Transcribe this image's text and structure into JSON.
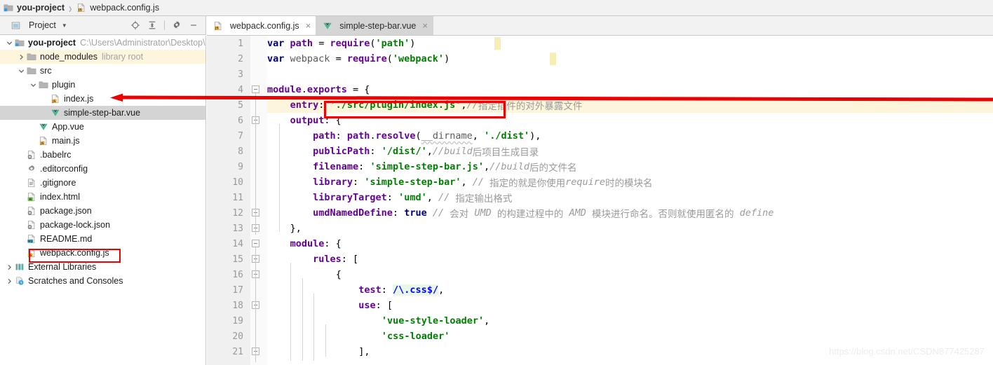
{
  "breadcrumb": {
    "project": "you-project",
    "separator": "›",
    "file": "webpack.config.js",
    "project_icon": "module-folder-icon",
    "file_icon": "js-file-icon"
  },
  "project_panel": {
    "title": "Project",
    "caret": "▼",
    "tools": [
      {
        "name": "locate-icon",
        "title": "Select Opened File"
      },
      {
        "name": "collapse-all-icon",
        "title": "Collapse All"
      },
      {
        "name": "gear-icon",
        "title": "Settings"
      },
      {
        "name": "minimize-icon",
        "title": "Hide"
      }
    ]
  },
  "tabs": [
    {
      "label": "webpack.config.js",
      "icon": "js-file-icon",
      "active": true,
      "close": "×"
    },
    {
      "label": "simple-step-bar.vue",
      "icon": "vue-file-icon",
      "active": false,
      "close": "×"
    }
  ],
  "tree": [
    {
      "depth": 0,
      "arrow": "expanded",
      "icon": "module-folder-icon",
      "name": "you-project",
      "bold": true,
      "note": "C:\\Users\\Administrator\\Desktop\\t",
      "state": "normal"
    },
    {
      "depth": 1,
      "arrow": "collapsed",
      "icon": "folder-icon",
      "name": "node_modules",
      "bold": false,
      "note": "library root",
      "state": "hl"
    },
    {
      "depth": 1,
      "arrow": "expanded",
      "icon": "folder-icon",
      "name": "src",
      "bold": false,
      "note": "",
      "state": "normal"
    },
    {
      "depth": 2,
      "arrow": "expanded",
      "icon": "folder-icon",
      "name": "plugin",
      "bold": false,
      "note": "",
      "state": "normal"
    },
    {
      "depth": 3,
      "arrow": "none",
      "icon": "js-file-icon",
      "name": "index.js",
      "bold": false,
      "note": "",
      "state": "normal"
    },
    {
      "depth": 3,
      "arrow": "none",
      "icon": "vue-file-icon",
      "name": "simple-step-bar.vue",
      "bold": false,
      "note": "",
      "state": "selected"
    },
    {
      "depth": 2,
      "arrow": "none",
      "icon": "vue-file-icon",
      "name": "App.vue",
      "bold": false,
      "note": "",
      "state": "normal"
    },
    {
      "depth": 2,
      "arrow": "none",
      "icon": "js-file-icon",
      "name": "main.js",
      "bold": false,
      "note": "",
      "state": "normal"
    },
    {
      "depth": 1,
      "arrow": "none",
      "icon": "json-file-icon",
      "name": ".babelrc",
      "bold": false,
      "note": "",
      "state": "normal"
    },
    {
      "depth": 1,
      "arrow": "none",
      "icon": "gear-file-icon",
      "name": ".editorconfig",
      "bold": false,
      "note": "",
      "state": "normal"
    },
    {
      "depth": 1,
      "arrow": "none",
      "icon": "text-file-icon",
      "name": ".gitignore",
      "bold": false,
      "note": "",
      "state": "normal"
    },
    {
      "depth": 1,
      "arrow": "none",
      "icon": "html-file-icon",
      "name": "index.html",
      "bold": false,
      "note": "",
      "state": "normal"
    },
    {
      "depth": 1,
      "arrow": "none",
      "icon": "json-file-icon",
      "name": "package.json",
      "bold": false,
      "note": "",
      "state": "normal"
    },
    {
      "depth": 1,
      "arrow": "none",
      "icon": "json-file-icon",
      "name": "package-lock.json",
      "bold": false,
      "note": "",
      "state": "normal"
    },
    {
      "depth": 1,
      "arrow": "none",
      "icon": "md-file-icon",
      "name": "README.md",
      "bold": false,
      "note": "",
      "state": "normal"
    },
    {
      "depth": 1,
      "arrow": "none",
      "icon": "js-file-icon",
      "name": "webpack.config.js",
      "bold": false,
      "note": "",
      "state": "normal"
    },
    {
      "depth": 0,
      "arrow": "collapsed",
      "icon": "external-libraries-icon",
      "name": "External Libraries",
      "bold": false,
      "note": "",
      "state": "normal"
    },
    {
      "depth": 0,
      "arrow": "collapsed",
      "icon": "scratches-icon",
      "name": "Scratches and Consoles",
      "bold": false,
      "note": "",
      "state": "normal"
    }
  ],
  "code": {
    "language": "javascript",
    "first_line": 1,
    "last_line": 21,
    "lines": [
      {
        "n": 1,
        "text": "var path = require('path')"
      },
      {
        "n": 2,
        "text": "var webpack = require('webpack')"
      },
      {
        "n": 3,
        "text": ""
      },
      {
        "n": 4,
        "text": "module.exports = {"
      },
      {
        "n": 5,
        "text": "    entry: './src/plugin/index.js',//指定插件的对外暴露文件"
      },
      {
        "n": 6,
        "text": "    output: {"
      },
      {
        "n": 7,
        "text": "        path: path.resolve(__dirname, './dist'),"
      },
      {
        "n": 8,
        "text": "        publicPath: '/dist/',//build后项目生成目录"
      },
      {
        "n": 9,
        "text": "        filename: 'simple-step-bar.js',//build后的文件名"
      },
      {
        "n": 10,
        "text": "        library: 'simple-step-bar', // 指定的就是你使用require时的模块名"
      },
      {
        "n": 11,
        "text": "        libraryTarget: 'umd', // 指定输出格式"
      },
      {
        "n": 12,
        "text": "        umdNamedDefine: true // 会对 UMD 的构建过程中的 AMD 模块进行命名。否则就使用匿名的 define"
      },
      {
        "n": 13,
        "text": "    },"
      },
      {
        "n": 14,
        "text": "    module: {"
      },
      {
        "n": 15,
        "text": "        rules: ["
      },
      {
        "n": 16,
        "text": "            {"
      },
      {
        "n": 17,
        "text": "                test: /\\.css$/,"
      },
      {
        "n": 18,
        "text": "                use: ["
      },
      {
        "n": 19,
        "text": "                    'vue-style-loader',"
      },
      {
        "n": 20,
        "text": "                    'css-loader'"
      },
      {
        "n": 21,
        "text": "                ],"
      }
    ]
  },
  "annotations": {
    "arrow_color": "#ee0000",
    "box_color": "#ee0000",
    "arrow_label": "red-arrow-entry-to-index-js",
    "box_entry_label": "red-box-entry-path",
    "box_file_label": "red-box-webpack-config-js"
  },
  "watermark": "https://blog.csdn.net/CSDN877425287",
  "colors": {
    "panel_bg": "#f2f2f2",
    "selected_row": "#d4d4d4",
    "current_line": "#fdf6dd",
    "gutter_bg": "#f0f0f0",
    "keyword": "#000080",
    "string": "#008000",
    "property": "#660099",
    "comment": "#9a9a9a",
    "accent_red": "#ee0000"
  }
}
